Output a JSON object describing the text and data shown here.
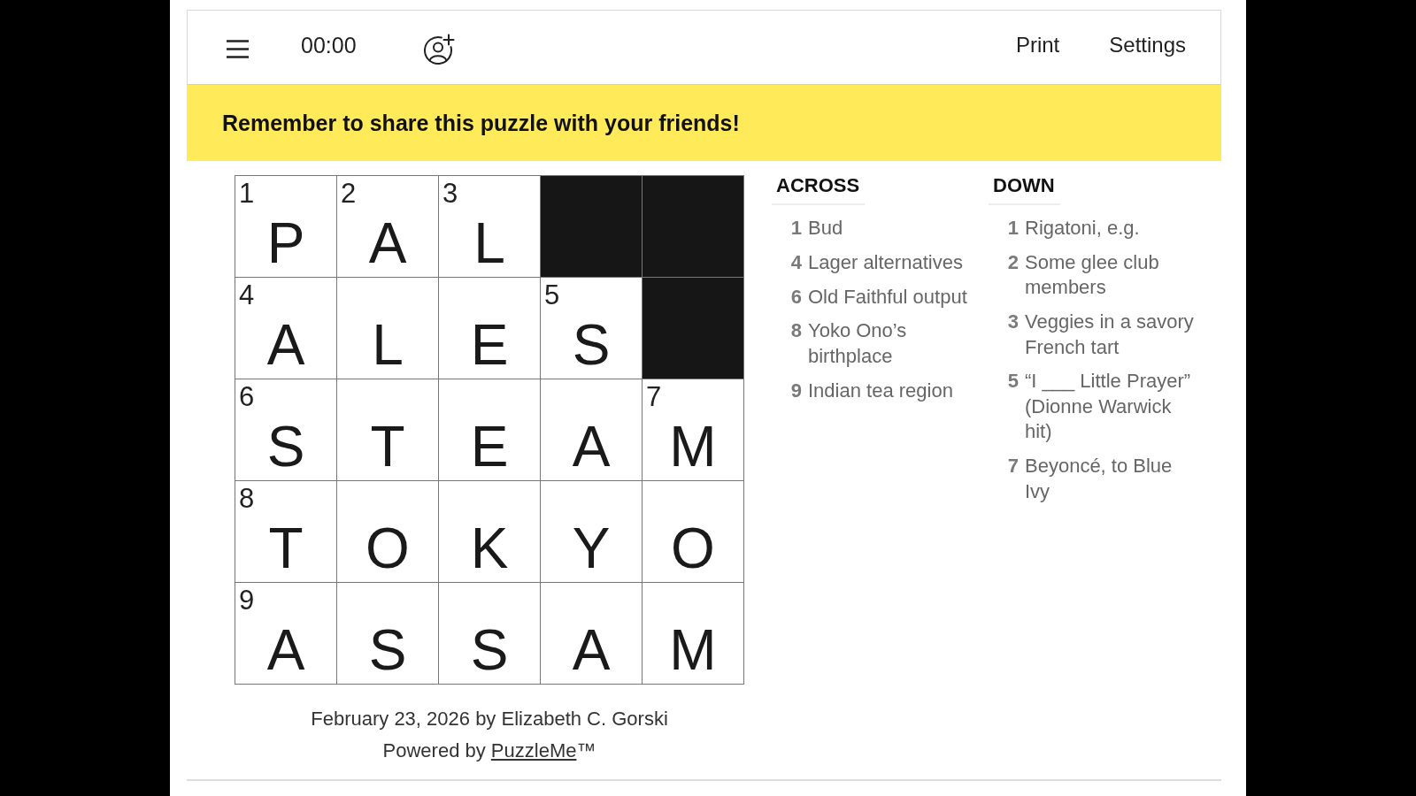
{
  "toolbar": {
    "timer": "00:00",
    "links": [
      "Print",
      "Settings"
    ]
  },
  "banner": "Remember to share this puzzle with your friends!",
  "grid": {
    "rows": [
      [
        {
          "kind": "letter",
          "number": "1",
          "letter": "P"
        },
        {
          "kind": "letter",
          "number": "2",
          "letter": "A"
        },
        {
          "kind": "letter",
          "number": "3",
          "letter": "L"
        },
        {
          "kind": "block"
        },
        {
          "kind": "block"
        }
      ],
      [
        {
          "kind": "letter",
          "number": "4",
          "letter": "A"
        },
        {
          "kind": "letter",
          "letter": "L"
        },
        {
          "kind": "letter",
          "letter": "E"
        },
        {
          "kind": "letter",
          "number": "5",
          "letter": "S"
        },
        {
          "kind": "block"
        }
      ],
      [
        {
          "kind": "letter",
          "number": "6",
          "letter": "S"
        },
        {
          "kind": "letter",
          "letter": "T"
        },
        {
          "kind": "letter",
          "letter": "E"
        },
        {
          "kind": "letter",
          "letter": "A"
        },
        {
          "kind": "letter",
          "number": "7",
          "letter": "M"
        }
      ],
      [
        {
          "kind": "letter",
          "number": "8",
          "letter": "T"
        },
        {
          "kind": "letter",
          "letter": "O"
        },
        {
          "kind": "letter",
          "letter": "K"
        },
        {
          "kind": "letter",
          "letter": "Y"
        },
        {
          "kind": "letter",
          "letter": "O"
        }
      ],
      [
        {
          "kind": "letter",
          "number": "9",
          "letter": "A"
        },
        {
          "kind": "letter",
          "letter": "S"
        },
        {
          "kind": "letter",
          "letter": "S"
        },
        {
          "kind": "letter",
          "letter": "A"
        },
        {
          "kind": "letter",
          "letter": "M"
        }
      ]
    ]
  },
  "byline": "February 23, 2026 by Elizabeth C. Gorski",
  "credit": {
    "prefix": "Powered by",
    "link": "PuzzleMe",
    "suffix": "™"
  },
  "clue_lists": [
    {
      "heading": "ACROSS",
      "items": [
        {
          "number": "1",
          "text": "Bud"
        },
        {
          "number": "4",
          "text": "Lager alternatives"
        },
        {
          "number": "6",
          "text": "Old Faithful output"
        },
        {
          "number": "8",
          "text": "Yoko Ono’s birthplace"
        },
        {
          "number": "9",
          "text": "Indian tea region"
        }
      ]
    },
    {
      "heading": "DOWN",
      "items": [
        {
          "number": "1",
          "text": "Rigatoni, e.g."
        },
        {
          "number": "2",
          "text": "Some glee club members"
        },
        {
          "number": "3",
          "text": "Veggies in a savory French tart"
        },
        {
          "number": "5",
          "text": "“I ___ Little Prayer” (Dionne Warwick hit)"
        },
        {
          "number": "7",
          "text": "Beyoncé, to Blue Ivy"
        }
      ]
    }
  ]
}
